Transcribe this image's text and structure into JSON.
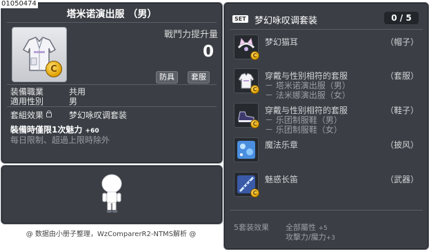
{
  "item_code": "01050474",
  "item": {
    "name": "塔米诺演出服 （男）",
    "power_label": "戰鬥力提升量",
    "power_value": "0",
    "tags": [
      "防具",
      "套服"
    ],
    "job_label": "装備職業",
    "job_value": "共用",
    "gender_label": "適用性別",
    "gender_value": "男",
    "set_label": "套組效果",
    "set_value": "梦幻咏叹调套装",
    "limit_line": "裝備時僅限1次魅力",
    "limit_bonus": "+60",
    "limit_note": "每日限制、超過上限時除外"
  },
  "footer": "@ 数据由小册子整理，WzComparerR2-NTMS解析 @",
  "set": {
    "badge": "SET",
    "name": "梦幻咏叹调套装",
    "count": "0 / 5",
    "items": [
      {
        "name": "梦幻猫耳",
        "type": "（帽子）",
        "icon": "cat-ears-icon",
        "subs": []
      },
      {
        "name": "穿戴与性别相符的套服",
        "type": "（套服）",
        "icon": "outfit-icon",
        "subs": [
          "－ 塔米诺演出服（男）",
          "－ 法米娜演出服（女）"
        ]
      },
      {
        "name": "穿戴与性别相符的套服",
        "type": "（鞋子）",
        "icon": "shoes-icon",
        "subs": [
          "－ 乐团制服鞋（男）",
          "－ 乐团制服鞋（女）"
        ]
      },
      {
        "name": "魔法乐章",
        "type": "（披风）",
        "icon": "cape-icon",
        "subs": []
      },
      {
        "name": "魅惑长笛",
        "type": "（武器）",
        "icon": "flute-icon",
        "subs": []
      }
    ],
    "effect_label": "5套装效果",
    "effects": [
      {
        "text": "全部屬性",
        "value": "+5"
      },
      {
        "text": "攻擊力/魔力",
        "value": "+3"
      }
    ]
  },
  "colors": {
    "panel_bg": "#3b3f45",
    "panel_border": "#6b7078",
    "text_primary": "#ffffff",
    "text_muted": "#9a9da3",
    "coin_gold": "#e0a000"
  }
}
